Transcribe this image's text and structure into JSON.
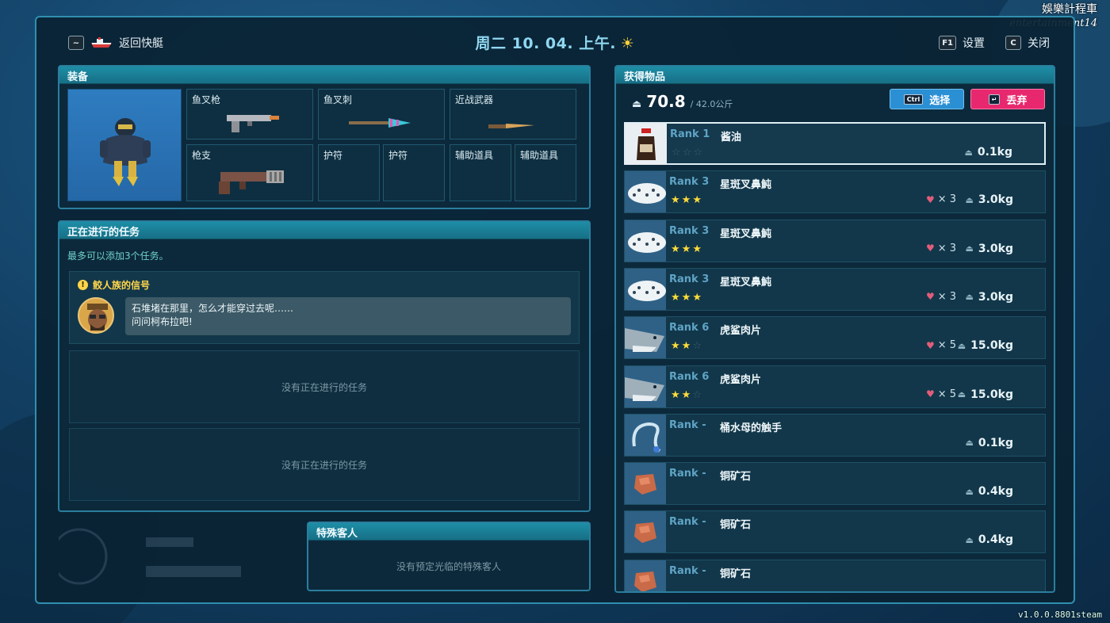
{
  "watermark": {
    "line1": "娛樂計程車",
    "line2": "entertainment14"
  },
  "version": "v1.0.0.8801steam",
  "topbar": {
    "back_key": "~",
    "back_label": "返回快艇",
    "date": "周二 10. 04. 上午.",
    "weather_icon": "sun-icon",
    "settings_key": "F1",
    "settings_label": "设置",
    "close_key": "C",
    "close_label": "关闭"
  },
  "equipment": {
    "title": "装备",
    "slots": [
      {
        "label": "鱼叉枪",
        "icon": "harpoon-gun-icon"
      },
      {
        "label": "鱼叉刺",
        "icon": "harpoon-spear-icon"
      },
      {
        "label": "近战武器",
        "icon": "knife-icon"
      },
      {
        "label": "枪支",
        "icon": "rifle-icon"
      },
      {
        "label": "护符",
        "icon": ""
      },
      {
        "label": "护符",
        "icon": ""
      },
      {
        "label": "辅助道具",
        "icon": ""
      },
      {
        "label": "辅助道具",
        "icon": ""
      }
    ]
  },
  "quests": {
    "title": "正在进行的任务",
    "note": "最多可以添加3个任务。",
    "active": {
      "title": "鲛人族的信号",
      "line1": "石堆堵在那里，怎么才能穿过去呢……",
      "line2": "问问柯布拉吧!"
    },
    "empty_label": "没有正在进行的任务"
  },
  "special_guest": {
    "title": "特殊客人",
    "message": "没有预定光临的特殊客人"
  },
  "inventory": {
    "title": "获得物品",
    "weight_current": "70.8",
    "weight_max": "/ 42.0公斤",
    "select_key": "Ctrl",
    "select_label": "选择",
    "discard_key": "↵",
    "discard_label": "丢弃",
    "items": [
      {
        "rank": "Rank 1",
        "name": "酱油",
        "stars": 0,
        "count": "",
        "weight": "0.1kg",
        "thumb": "soy-sauce-icon",
        "selected": true
      },
      {
        "rank": "Rank 3",
        "name": "星斑叉鼻魨",
        "stars": 3,
        "count": "× 3",
        "weight": "3.0kg",
        "thumb": "pufferfish-icon"
      },
      {
        "rank": "Rank 3",
        "name": "星斑叉鼻魨",
        "stars": 3,
        "count": "× 3",
        "weight": "3.0kg",
        "thumb": "pufferfish-icon"
      },
      {
        "rank": "Rank 3",
        "name": "星斑叉鼻魨",
        "stars": 3,
        "count": "× 3",
        "weight": "3.0kg",
        "thumb": "pufferfish-icon"
      },
      {
        "rank": "Rank 6",
        "name": "虎鲨肉片",
        "stars": 2,
        "count": "× 5",
        "weight": "15.0kg",
        "thumb": "tiger-shark-icon"
      },
      {
        "rank": "Rank 6",
        "name": "虎鲨肉片",
        "stars": 2,
        "count": "× 5",
        "weight": "15.0kg",
        "thumb": "tiger-shark-icon"
      },
      {
        "rank": "Rank -",
        "name": "桶水母的触手",
        "stars": -1,
        "count": "",
        "weight": "0.1kg",
        "thumb": "jellyfish-tentacle-icon"
      },
      {
        "rank": "Rank -",
        "name": "铜矿石",
        "stars": -1,
        "count": "",
        "weight": "0.4kg",
        "thumb": "copper-ore-icon"
      },
      {
        "rank": "Rank -",
        "name": "铜矿石",
        "stars": -1,
        "count": "",
        "weight": "0.4kg",
        "thumb": "copper-ore-icon"
      },
      {
        "rank": "Rank -",
        "name": "铜矿石",
        "stars": -1,
        "count": "",
        "weight": "",
        "thumb": "copper-ore-icon"
      }
    ]
  }
}
